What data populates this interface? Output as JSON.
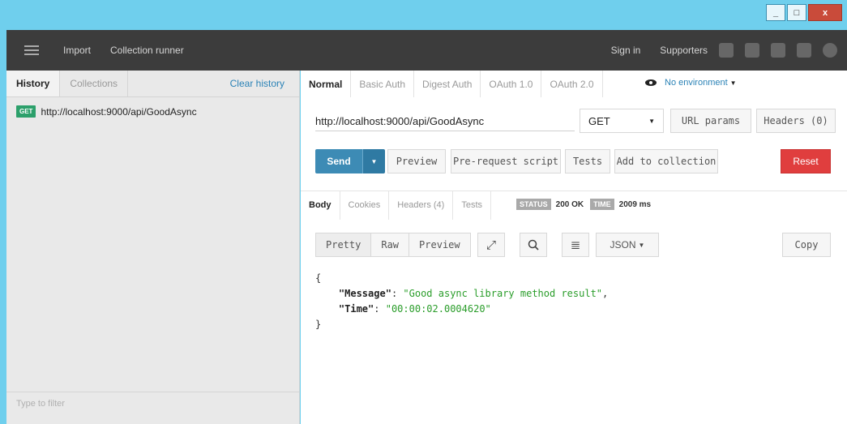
{
  "window": {
    "minimize": "_",
    "maximize": "□",
    "close": "x"
  },
  "toolbar": {
    "items": [
      "Import",
      "Collection runner"
    ],
    "sign_in": "Sign in",
    "supporters": "Supporters",
    "icons": [
      "traffic-light-icon",
      "code-icon",
      "wrench-icon",
      "twitter-icon",
      "help-icon"
    ]
  },
  "sidebar": {
    "tabs": [
      "History",
      "Collections"
    ],
    "clear_history": "Clear history",
    "history": [
      {
        "method": "GET",
        "url": "http://localhost:9000/api/GoodAsync"
      }
    ],
    "filter_placeholder": "Type to filter"
  },
  "auth_tabs": [
    "Normal",
    "Basic Auth",
    "Digest Auth",
    "OAuth 1.0",
    "OAuth 2.0"
  ],
  "environment": "No environment",
  "request": {
    "url": "http://localhost:9000/api/GoodAsync",
    "method": "GET",
    "url_params": "URL params",
    "headers": "Headers (0)"
  },
  "actions": {
    "send": "Send",
    "preview": "Preview",
    "pre_request": "Pre-request script",
    "tests": "Tests",
    "add_to_collection": "Add to collection",
    "reset": "Reset"
  },
  "response": {
    "tabs": [
      "Body",
      "Cookies",
      "Headers (4)",
      "Tests"
    ],
    "status_label": "STATUS",
    "status": "200 OK",
    "time_label": "TIME",
    "time": "2009 ms",
    "views": [
      "Pretty",
      "Raw",
      "Preview"
    ],
    "format": "JSON",
    "copy": "Copy",
    "body": {
      "open": "{",
      "close": "}",
      "lines": [
        {
          "key": "\"Message\"",
          "value": "\"Good async library method result\"",
          "sep": ": ",
          "end": ","
        },
        {
          "key": "\"Time\"",
          "value": "\"00:00:02.0004620\"",
          "sep": ": ",
          "end": ""
        }
      ]
    }
  },
  "colors": {
    "accent": "#3d8bb5",
    "reset": "#e03e3e",
    "get_badge": "#2ca06b",
    "title_bar": "#6fcfed"
  }
}
